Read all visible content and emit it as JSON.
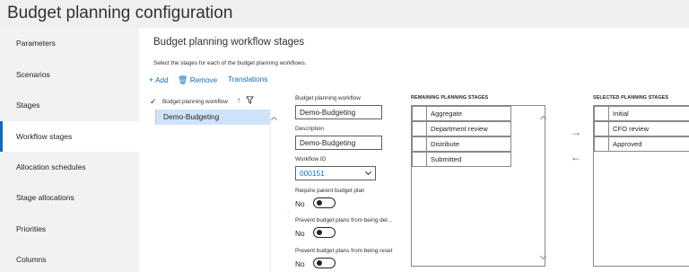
{
  "page": {
    "title": "Budget planning configuration"
  },
  "sidebar": {
    "items": [
      {
        "label": "Parameters"
      },
      {
        "label": "Scenarios"
      },
      {
        "label": "Stages"
      },
      {
        "label": "Workflow stages",
        "active": true
      },
      {
        "label": "Allocation schedules"
      },
      {
        "label": "Stage allocations"
      },
      {
        "label": "Priorities"
      },
      {
        "label": "Columns"
      }
    ]
  },
  "main": {
    "section_title": "Budget planning workflow stages",
    "instructions": "Select the stages for each of the budget planning workflows.",
    "toolbar": {
      "add_icon": "+",
      "add_label": "Add",
      "remove_icon": "🗑",
      "remove_label": "Remove",
      "translations_label": "Translations"
    },
    "grid": {
      "column_header": "Budget planning workflow",
      "sort_icon": "↑",
      "rows": [
        {
          "value": "Demo-Budgeting",
          "selected": true
        }
      ]
    }
  },
  "form": {
    "workflow_label": "Budget planning workflow",
    "workflow_value": "Demo-Budgeting",
    "description_label": "Description",
    "description_value": "Demo-Budgeting",
    "workflow_id_label": "Workflow ID",
    "workflow_id_value": "000151",
    "require_parent_label": "Require parent budget plan",
    "require_parent_value": "No",
    "prevent_delete_label": "Prevent budget plans from being del...",
    "prevent_delete_value": "No",
    "prevent_reset_label": "Prevent budget plans from being reset",
    "prevent_reset_value": "No"
  },
  "remaining": {
    "title": "REMAINING PLANNING STAGES",
    "items": [
      "Aggregate",
      "Department review",
      "Distribute",
      "Submitted"
    ]
  },
  "selected": {
    "title": "SELECTED PLANNING STAGES",
    "items": [
      "Initial",
      "CFO review",
      "Approved"
    ]
  },
  "move": {
    "right_icon": "→",
    "left_icon": "←"
  },
  "colors": {
    "accent": "#0f6cbd",
    "selected_row": "#cfe4fa",
    "nav_bg": "#f2f2f2",
    "header_bg": "#eef0f2"
  }
}
